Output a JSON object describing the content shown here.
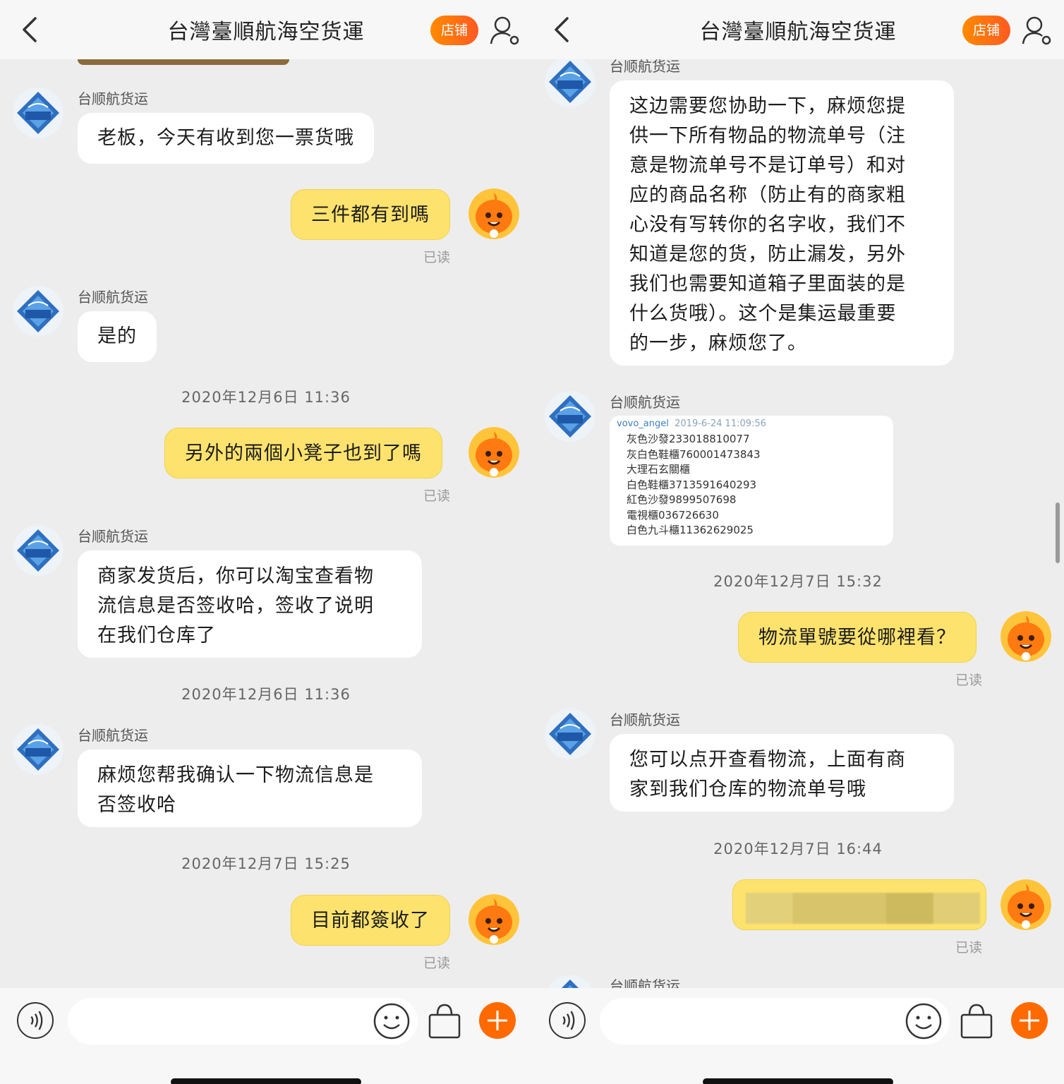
{
  "header": {
    "title": "台灣臺順航海空货運",
    "shop_label": "店铺"
  },
  "left": {
    "messages": [
      {
        "sender": "台顺航货运",
        "text": "老板，今天有收到您一票货哦"
      },
      {
        "text": "三件都有到嗎",
        "status": "已读"
      },
      {
        "sender": "台顺航货运",
        "text": "是的"
      },
      {
        "time": "2020年12月6日 11:36"
      },
      {
        "text": "另外的兩個小凳子也到了嗎",
        "status": "已读"
      },
      {
        "sender": "台顺航货运",
        "text_lines": [
          "商家发货后，你可以淘宝查看物",
          "流信息是否签收哈，签收了说明",
          "在我们仓库了"
        ]
      },
      {
        "time": "2020年12月6日 11:36"
      },
      {
        "sender": "台顺航货运",
        "text_lines": [
          "麻烦您帮我确认一下物流信息是",
          "否签收哈"
        ]
      },
      {
        "time": "2020年12月7日 15:25"
      },
      {
        "text": "目前都簽收了",
        "status": "已读"
      }
    ]
  },
  "right": {
    "messages": [
      {
        "sender": "台顺航货运",
        "text_lines": [
          "这边需要您协助一下，麻烦您提",
          "供一下所有物品的物流单号（注",
          "意是物流单号不是订单号）和对",
          "应的商品名称（防止有的商家粗",
          "心没有写转你的名字收，我们不",
          "知道是您的货，防止漏发，另外",
          "我们也需要知道箱子里面装的是",
          "什么货哦）。这个是集运最重要",
          "的一步，麻烦您了。"
        ]
      },
      {
        "sender": "台顺航货运",
        "image": {
          "user": "vovo_angel",
          "date": "2019-6-24 11:09:56",
          "lines": [
            "灰色沙發233018810077",
            "灰白色鞋櫃760001473843",
            "大理石玄關櫃",
            "白色鞋櫃3713591640293",
            "紅色沙發9899507698",
            "電視櫃036726630",
            "白色九斗櫃11362629025"
          ]
        }
      },
      {
        "time": "2020年12月7日 15:32"
      },
      {
        "text": "物流單號要從哪裡看？",
        "status": "已读"
      },
      {
        "sender": "台顺航货运",
        "text_lines": [
          "您可以点开查看物流，上面有商",
          "家到我们仓库的物流单号哦"
        ]
      },
      {
        "time": "2020年12月7日 16:44"
      },
      {
        "status": "已读"
      },
      {
        "sender": "台顺航货运"
      }
    ]
  },
  "colors": {
    "accent": "#ff6a00",
    "bubble_out": "#fde36e",
    "bubble_in": "#ffffff",
    "background": "#ededed"
  },
  "icons": [
    "back-icon",
    "user-settings-icon",
    "voice-icon",
    "emoji-icon",
    "bag-icon",
    "plus-icon",
    "logo-avatar",
    "mascot-avatar"
  ]
}
